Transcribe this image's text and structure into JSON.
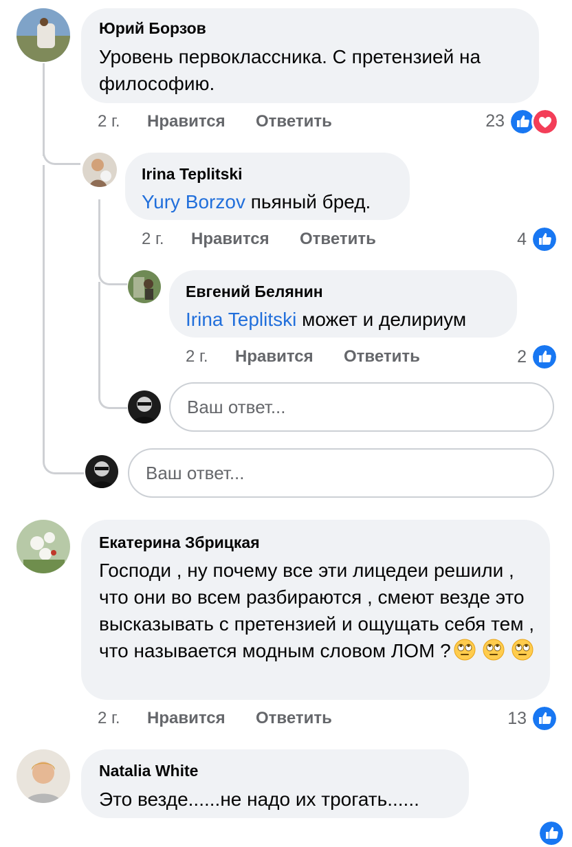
{
  "comments": [
    {
      "author": "Юрий Борзов",
      "text": "Уровень первоклассника. С претензией на философию.",
      "time": "2 г.",
      "like": "Нравится",
      "reply": "Ответить",
      "reactions_count": "23",
      "reactions": [
        "like-icon",
        "love-icon"
      ],
      "replies": [
        {
          "author": "Irina Teplitski",
          "mention": "Yury Borzov",
          "text": " пьяный бред.",
          "time": "2 г.",
          "like": "Нравится",
          "reply": "Ответить",
          "reactions_count": "4",
          "reactions": [
            "like-icon"
          ]
        },
        {
          "author": "Евгений Белянин",
          "mention": "Irina Teplitski",
          "text": " может и делириум",
          "time": "2 г.",
          "like": "Нравится",
          "reply": "Ответить",
          "reactions_count": "2",
          "reactions": [
            "like-icon"
          ]
        }
      ]
    },
    {
      "author": "Екатерина Збрицкая",
      "text": "Господи , ну почему все эти лицедеи решили , что они во всем разбираются , смеют везде это высказывать с претензией и ощущать себя тем , что называется модным словом ЛОМ ?",
      "emojis": [
        "eye-roll-emoji",
        "eye-roll-emoji",
        "eye-roll-emoji"
      ],
      "time": "2 г.",
      "like": "Нравится",
      "reply": "Ответить",
      "reactions_count": "13",
      "reactions": [
        "like-icon"
      ]
    },
    {
      "author": "Natalia White",
      "text": "Это везде......не надо их трогать......"
    }
  ],
  "reply_placeholder_nested": "Ваш ответ...",
  "reply_placeholder": "Ваш ответ...",
  "colors": {
    "bubble": "#f0f2f5",
    "mention": "#216fdb",
    "meta": "#65676b",
    "like": "#1877f2",
    "love": "#f33e58"
  }
}
